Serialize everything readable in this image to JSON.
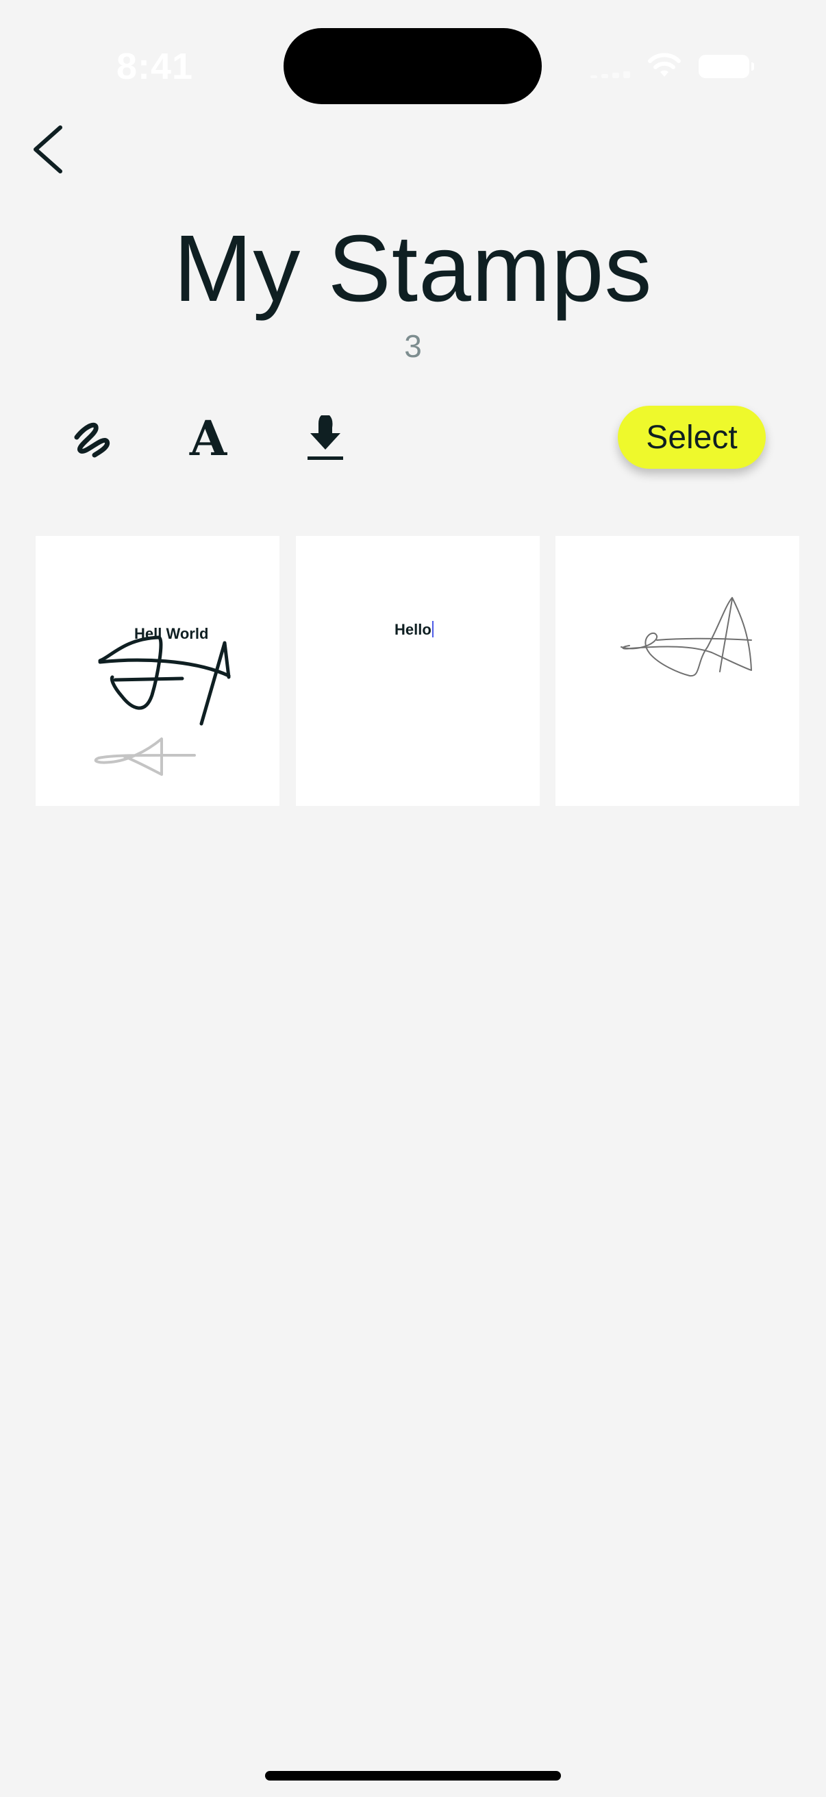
{
  "status_bar": {
    "time": "8:41",
    "icons": [
      "signal-icon",
      "wifi-icon",
      "battery-icon"
    ]
  },
  "header": {
    "back_icon": "chevron-left-icon",
    "title": "My Stamps",
    "count": "3"
  },
  "toolbar": {
    "tools": [
      {
        "name": "draw-signature",
        "icon": "signature-scribble-icon"
      },
      {
        "name": "add-text",
        "icon": "text-a-icon",
        "glyph": "A"
      },
      {
        "name": "import",
        "icon": "download-icon"
      }
    ],
    "select_label": "Select"
  },
  "stamps": [
    {
      "text": "Hell World",
      "kind": "text-and-drawing"
    },
    {
      "text": "Hello",
      "kind": "text"
    },
    {
      "text": "",
      "kind": "drawing"
    }
  ],
  "colors": {
    "background": "#f4f4f4",
    "accent": "#eef92c",
    "text": "#0f1f22",
    "muted": "#7d8d8f"
  }
}
